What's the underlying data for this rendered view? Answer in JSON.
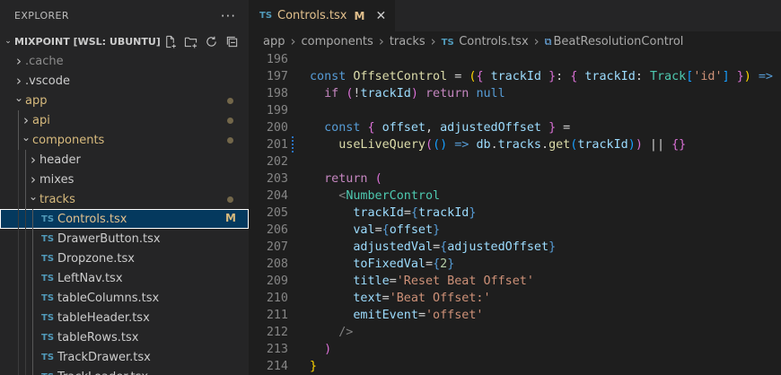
{
  "explorer": {
    "title": "EXPLORER",
    "more_label": "···",
    "workspace": "MIXPOINT [WSL: UBUNTU]",
    "actions": [
      {
        "name": "new-file-icon"
      },
      {
        "name": "new-folder-icon"
      },
      {
        "name": "refresh-icon"
      },
      {
        "name": "collapse-all-icon"
      }
    ],
    "tree": [
      {
        "kind": "folder",
        "label": ".cache",
        "depth": 1,
        "open": false,
        "color": "ignored",
        "dot": false
      },
      {
        "kind": "folder",
        "label": ".vscode",
        "depth": 1,
        "open": false,
        "color": "plain",
        "dot": false
      },
      {
        "kind": "folder",
        "label": "app",
        "depth": 1,
        "open": true,
        "color": "mod",
        "dot": true
      },
      {
        "kind": "folder",
        "label": "api",
        "depth": 2,
        "open": false,
        "color": "mod",
        "dot": true
      },
      {
        "kind": "folder",
        "label": "components",
        "depth": 2,
        "open": true,
        "color": "mod",
        "dot": true
      },
      {
        "kind": "folder",
        "label": "header",
        "depth": 3,
        "open": false,
        "color": "plain",
        "dot": false
      },
      {
        "kind": "folder",
        "label": "mixes",
        "depth": 3,
        "open": false,
        "color": "plain",
        "dot": false
      },
      {
        "kind": "folder",
        "label": "tracks",
        "depth": 3,
        "open": true,
        "color": "mod",
        "dot": true
      },
      {
        "kind": "file",
        "label": "Controls.tsx",
        "depth": 4,
        "color": "mod",
        "badge": "M",
        "selected": true
      },
      {
        "kind": "file",
        "label": "DrawerButton.tsx",
        "depth": 4,
        "color": "plain"
      },
      {
        "kind": "file",
        "label": "Dropzone.tsx",
        "depth": 4,
        "color": "plain"
      },
      {
        "kind": "file",
        "label": "LeftNav.tsx",
        "depth": 4,
        "color": "plain"
      },
      {
        "kind": "file",
        "label": "tableColumns.tsx",
        "depth": 4,
        "color": "plain"
      },
      {
        "kind": "file",
        "label": "tableHeader.tsx",
        "depth": 4,
        "color": "plain"
      },
      {
        "kind": "file",
        "label": "tableRows.tsx",
        "depth": 4,
        "color": "plain"
      },
      {
        "kind": "file",
        "label": "TrackDrawer.tsx",
        "depth": 4,
        "color": "plain"
      },
      {
        "kind": "file",
        "label": "TrackLoader.tsx",
        "depth": 4,
        "color": "plain"
      }
    ]
  },
  "editor": {
    "tab": {
      "icon": "TS",
      "label": "Controls.tsx",
      "status": "M",
      "close": "✕"
    },
    "breadcrumb": [
      "app",
      "components",
      "tracks",
      "Controls.tsx",
      "BeatResolutionControl"
    ],
    "file_icon": "TS",
    "lines": [
      {
        "n": "196",
        "tokens": []
      },
      {
        "n": "197",
        "tokens": [
          [
            "kw",
            "const"
          ],
          [
            "pl",
            " "
          ],
          [
            "fn",
            "OffsetControl"
          ],
          [
            "pl",
            " = "
          ],
          [
            "br1",
            "("
          ],
          [
            "br2",
            "{"
          ],
          [
            "pl",
            " "
          ],
          [
            "id",
            "trackId"
          ],
          [
            "pl",
            " "
          ],
          [
            "br2",
            "}"
          ],
          [
            "pl",
            ": "
          ],
          [
            "br2",
            "{"
          ],
          [
            "pl",
            " "
          ],
          [
            "id",
            "trackId"
          ],
          [
            "pl",
            ": "
          ],
          [
            "ty",
            "Track"
          ],
          [
            "br3",
            "["
          ],
          [
            "str",
            "'id'"
          ],
          [
            "br3",
            "]"
          ],
          [
            "pl",
            " "
          ],
          [
            "br2",
            "}"
          ],
          [
            "br1",
            ")"
          ],
          [
            "pl",
            " "
          ],
          [
            "kw",
            "=>"
          ],
          [
            "pl",
            " "
          ],
          [
            "br1",
            "{"
          ]
        ]
      },
      {
        "n": "198",
        "tokens": [
          [
            "pl",
            "  "
          ],
          [
            "kw2",
            "if"
          ],
          [
            "pl",
            " "
          ],
          [
            "br2",
            "("
          ],
          [
            "pl",
            "!"
          ],
          [
            "id",
            "trackId"
          ],
          [
            "br2",
            ")"
          ],
          [
            "pl",
            " "
          ],
          [
            "kw2",
            "return"
          ],
          [
            "pl",
            " "
          ],
          [
            "kw",
            "null"
          ]
        ]
      },
      {
        "n": "199",
        "tokens": []
      },
      {
        "n": "200",
        "tokens": [
          [
            "pl",
            "  "
          ],
          [
            "kw",
            "const"
          ],
          [
            "pl",
            " "
          ],
          [
            "br2",
            "{"
          ],
          [
            "pl",
            " "
          ],
          [
            "id",
            "offset"
          ],
          [
            "pl",
            ", "
          ],
          [
            "id",
            "adjustedOffset"
          ],
          [
            "pl",
            " "
          ],
          [
            "br2",
            "}"
          ],
          [
            "pl",
            " ="
          ]
        ]
      },
      {
        "n": "201",
        "mod": true,
        "tokens": [
          [
            "pl",
            "    "
          ],
          [
            "fn",
            "useLiveQuery"
          ],
          [
            "br2",
            "("
          ],
          [
            "br3",
            "("
          ],
          [
            "br3",
            ")"
          ],
          [
            "pl",
            " "
          ],
          [
            "kw",
            "=>"
          ],
          [
            "pl",
            " "
          ],
          [
            "id",
            "db"
          ],
          [
            "pl",
            "."
          ],
          [
            "id",
            "tracks"
          ],
          [
            "pl",
            "."
          ],
          [
            "fn",
            "get"
          ],
          [
            "br3",
            "("
          ],
          [
            "id",
            "trackId"
          ],
          [
            "br3",
            ")"
          ],
          [
            "br2",
            ")"
          ],
          [
            "pl",
            " || "
          ],
          [
            "br2",
            "{}"
          ]
        ]
      },
      {
        "n": "202",
        "tokens": []
      },
      {
        "n": "203",
        "tokens": [
          [
            "pl",
            "  "
          ],
          [
            "kw2",
            "return"
          ],
          [
            "pl",
            " "
          ],
          [
            "br2",
            "("
          ]
        ]
      },
      {
        "n": "204",
        "tokens": [
          [
            "pl",
            "    "
          ],
          [
            "tagp",
            "<"
          ],
          [
            "tag",
            "NumberControl"
          ]
        ]
      },
      {
        "n": "205",
        "tokens": [
          [
            "pl",
            "      "
          ],
          [
            "attr",
            "trackId"
          ],
          [
            "pl",
            "="
          ],
          [
            "kw",
            "{"
          ],
          [
            "id",
            "trackId"
          ],
          [
            "kw",
            "}"
          ]
        ]
      },
      {
        "n": "206",
        "tokens": [
          [
            "pl",
            "      "
          ],
          [
            "attr",
            "val"
          ],
          [
            "pl",
            "="
          ],
          [
            "kw",
            "{"
          ],
          [
            "id",
            "offset"
          ],
          [
            "kw",
            "}"
          ]
        ]
      },
      {
        "n": "207",
        "tokens": [
          [
            "pl",
            "      "
          ],
          [
            "attr",
            "adjustedVal"
          ],
          [
            "pl",
            "="
          ],
          [
            "kw",
            "{"
          ],
          [
            "id",
            "adjustedOffset"
          ],
          [
            "kw",
            "}"
          ]
        ]
      },
      {
        "n": "208",
        "tokens": [
          [
            "pl",
            "      "
          ],
          [
            "attr",
            "toFixedVal"
          ],
          [
            "pl",
            "="
          ],
          [
            "kw",
            "{"
          ],
          [
            "num",
            "2"
          ],
          [
            "kw",
            "}"
          ]
        ]
      },
      {
        "n": "209",
        "tokens": [
          [
            "pl",
            "      "
          ],
          [
            "attr",
            "title"
          ],
          [
            "pl",
            "="
          ],
          [
            "str",
            "'Reset Beat Offset'"
          ]
        ]
      },
      {
        "n": "210",
        "tokens": [
          [
            "pl",
            "      "
          ],
          [
            "attr",
            "text"
          ],
          [
            "pl",
            "="
          ],
          [
            "str",
            "'Beat Offset:'"
          ]
        ]
      },
      {
        "n": "211",
        "tokens": [
          [
            "pl",
            "      "
          ],
          [
            "attr",
            "emitEvent"
          ],
          [
            "pl",
            "="
          ],
          [
            "str",
            "'offset'"
          ]
        ]
      },
      {
        "n": "212",
        "tokens": [
          [
            "pl",
            "    "
          ],
          [
            "tagp",
            "/>"
          ]
        ]
      },
      {
        "n": "213",
        "tokens": [
          [
            "pl",
            "  "
          ],
          [
            "br2",
            ")"
          ]
        ]
      },
      {
        "n": "214",
        "tokens": [
          [
            "br1",
            "}"
          ]
        ]
      }
    ]
  }
}
